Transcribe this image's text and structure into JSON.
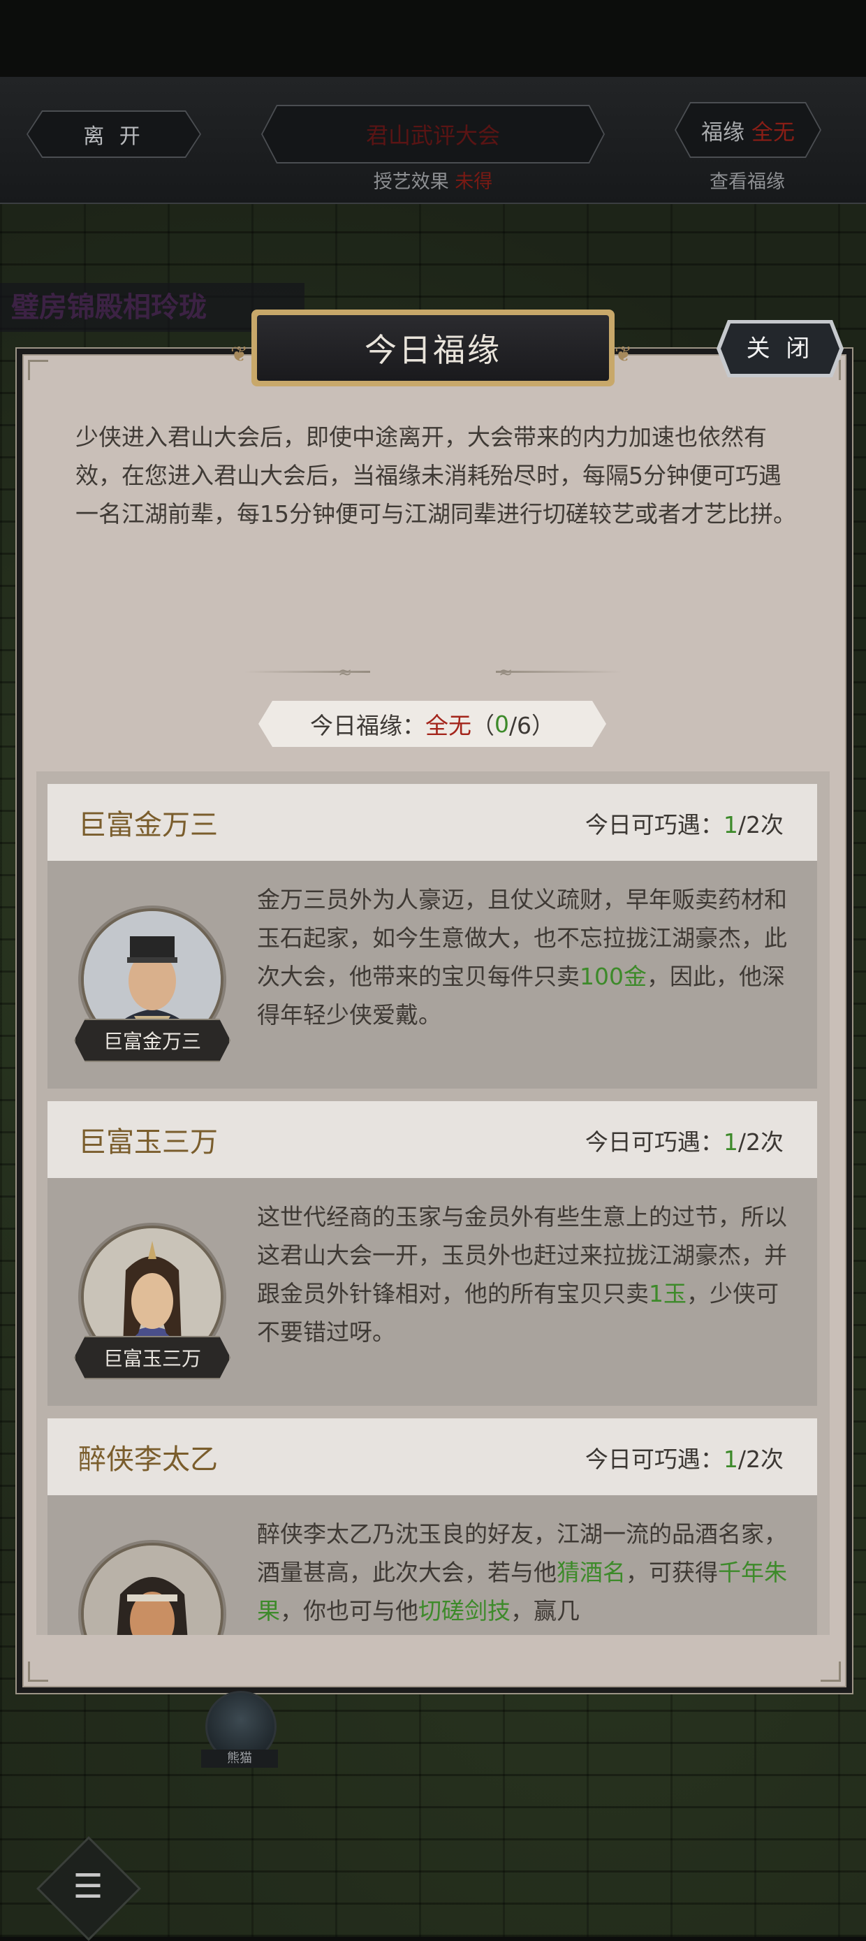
{
  "topbar": {
    "leave_label": "离 开",
    "event_title": "君山武评大会",
    "skill_effect_label": "授艺效果",
    "skill_effect_value": "未得",
    "fortune_label": "福缘",
    "fortune_value": "全无",
    "view_fortune_label": "查看福缘"
  },
  "background": {
    "banner_text": "璧房锦殿相玲珑",
    "bottom_avatar_name": "熊猫"
  },
  "dialog": {
    "title": "今日福缘",
    "close_label": "关 闭",
    "intro": "少侠进入君山大会后，即使中途离开，大会带来的内力加速也依然有效，在您进入君山大会后，当福缘未消耗殆尽时，每隔5分钟便可巧遇一名江湖前辈，每15分钟便可与江湖同辈进行切磋较艺或者才艺比拼。",
    "fortune_prefix": "今日福缘：",
    "fortune_value": "全无",
    "fortune_paren_open": "（",
    "fortune_used": "0",
    "fortune_total": "/6）"
  },
  "encounters": [
    {
      "name": "巨富金万三",
      "count_label": "今日可巧遇：",
      "count_current": "1",
      "count_rest": "/2次",
      "portrait_name": "巨富金万三",
      "desc_a": "金万三员外为人豪迈，且仗义疏财，早年贩卖药材和玉石起家，如今生意做大，也不忘拉拢江湖豪杰，此次大会，他带来的宝贝每件只卖",
      "desc_hl1": "100金",
      "desc_b": "，因此，他深得年轻少侠爱戴。"
    },
    {
      "name": "巨富玉三万",
      "count_label": "今日可巧遇：",
      "count_current": "1",
      "count_rest": "/2次",
      "portrait_name": "巨富玉三万",
      "desc_a": "这世代经商的玉家与金员外有些生意上的过节，所以这君山大会一开，玉员外也赶过来拉拢江湖豪杰，并跟金员外针锋相对，他的所有宝贝只卖",
      "desc_hl1": "1玉",
      "desc_b": "，少侠可不要错过呀。"
    },
    {
      "name": "醉侠李太乙",
      "count_label": "今日可巧遇：",
      "count_current": "1",
      "count_rest": "/2次",
      "desc_a": "醉侠李太乙乃沈玉良的好友，江湖一流的品酒名家，酒量甚高，此次大会，若与他",
      "desc_hl1": "猜酒名",
      "desc_b": "，可获得",
      "desc_hl2": "千年朱果",
      "desc_c": "，你也可与他",
      "desc_hl3": "切磋剑技",
      "desc_d": "，赢几"
    }
  ],
  "colors": {
    "highlight_green": "#3d8a2a",
    "highlight_red": "#a3241a",
    "name_gold": "#7a5d2c"
  }
}
